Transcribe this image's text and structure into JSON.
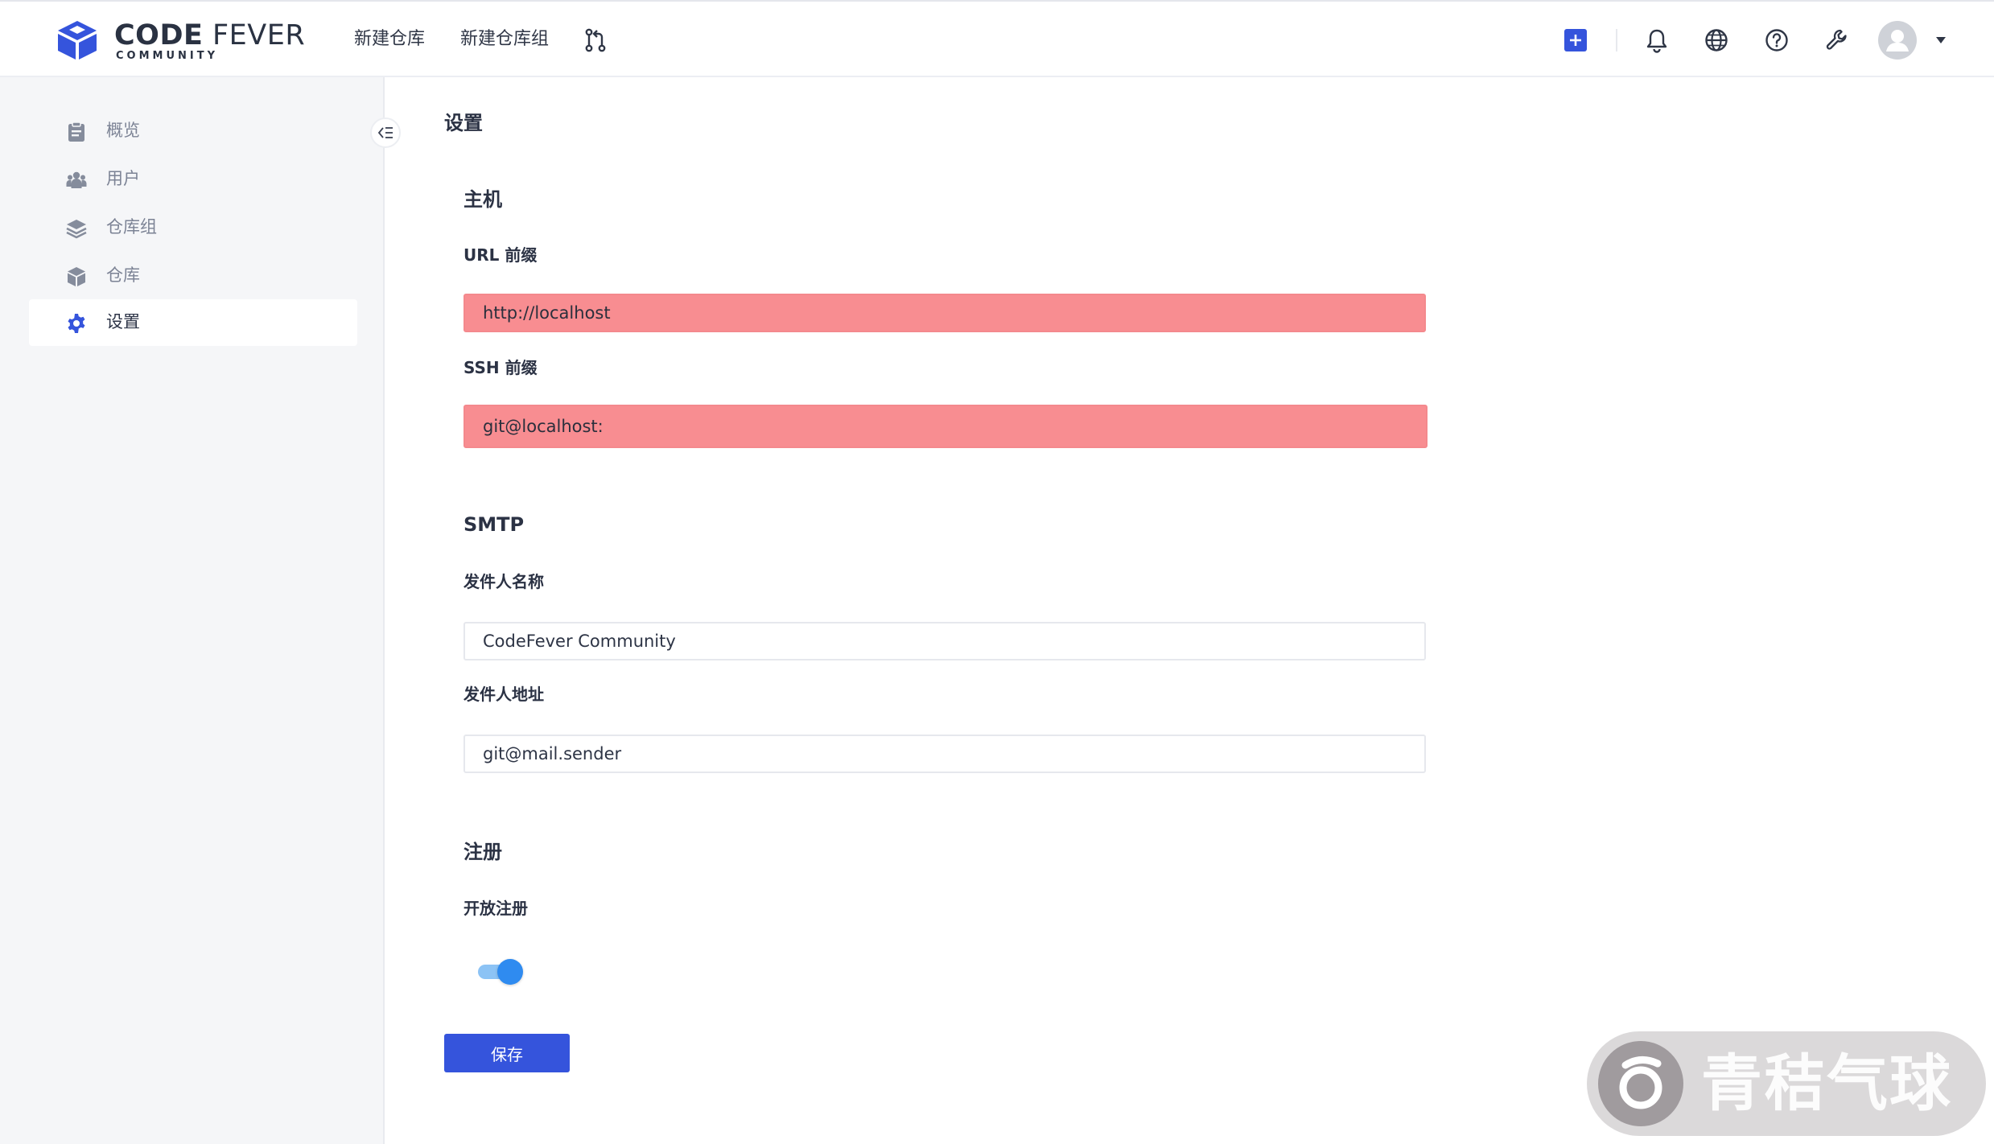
{
  "brand": {
    "title_bold": "CODE",
    "title_light": "FEVER",
    "subtitle": "COMMUNITY",
    "color": "#3554dc"
  },
  "topnav": {
    "new_repo": "新建仓库",
    "new_repo_group": "新建仓库组",
    "icons": [
      "pull-request-icon",
      "plus-square-icon",
      "bell-icon",
      "globe-icon",
      "help-icon",
      "wrench-icon",
      "avatar-icon",
      "caret-down-icon"
    ]
  },
  "sidebar": {
    "items": [
      {
        "label": "概览",
        "icon": "clipboard-icon"
      },
      {
        "label": "用户",
        "icon": "users-icon"
      },
      {
        "label": "仓库组",
        "icon": "layers-icon"
      },
      {
        "label": "仓库",
        "icon": "cube-icon"
      },
      {
        "label": "设置",
        "icon": "gear-icon",
        "active": true
      }
    ]
  },
  "main": {
    "page_title": "设置",
    "host": {
      "title": "主机",
      "url_label": "URL 前缀",
      "url_value": "http://localhost",
      "ssh_label": "SSH 前缀",
      "ssh_value": "git@localhost:"
    },
    "smtp": {
      "title": "SMTP",
      "sender_name_label": "发件人名称",
      "sender_name_value": "CodeFever Community",
      "sender_addr_label": "发件人地址",
      "sender_addr_value": "git@mail.sender"
    },
    "register": {
      "title": "注册",
      "open_label": "开放注册",
      "open_enabled": true
    },
    "save_label": "保存"
  },
  "watermark": {
    "text": "青秸气球"
  },
  "colors": {
    "accent": "#3554dc",
    "error_fill": "#f88d91",
    "switch_on": "#2f8bf0"
  }
}
